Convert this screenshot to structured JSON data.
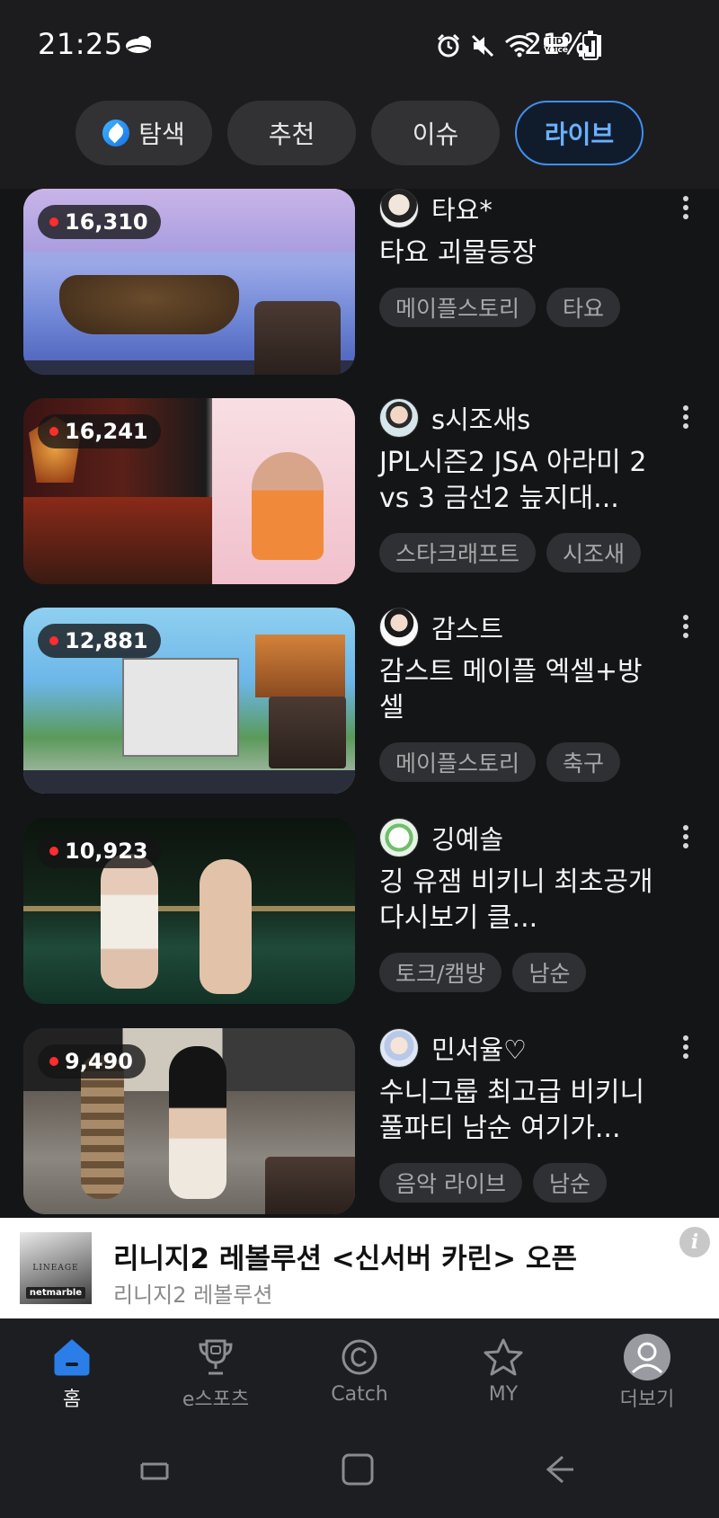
{
  "status_bar": {
    "time": "21:25",
    "battery_text": "21%",
    "hd_voice_top": "HD",
    "hd_voice_bottom": "Voice"
  },
  "tabs": [
    {
      "label": "탐색",
      "icon": "explore-leaf-icon",
      "active": false
    },
    {
      "label": "추천",
      "active": false
    },
    {
      "label": "이슈",
      "active": false
    },
    {
      "label": "라이브",
      "active": true
    }
  ],
  "streams": [
    {
      "viewers": "16,310",
      "channel": "타요*",
      "title": "타요 괴물등장",
      "tags": [
        "메이플스토리",
        "타요"
      ]
    },
    {
      "viewers": "16,241",
      "channel": "s시조새s",
      "title": "JPL시즌2 JSA 아라미 2 vs 3 금선2 늪지대...",
      "tags": [
        "스타크래프트",
        "시조새"
      ]
    },
    {
      "viewers": "12,881",
      "channel": "감스트",
      "title": "감스트 메이플 엑셀+방셀",
      "tags": [
        "메이플스토리",
        "축구"
      ]
    },
    {
      "viewers": "10,923",
      "channel": "깅예솔",
      "title": "깅 유잼 비키니 최초공개 다시보기 클...",
      "tags": [
        "토크/캠방",
        "남순"
      ]
    },
    {
      "viewers": "9,490",
      "channel": "민서율♡",
      "title": "수니그룹 최고급 비키니 풀파티 남순 여기가...",
      "tags": [
        "음악 라이브",
        "남순"
      ]
    }
  ],
  "ad": {
    "title": "리니지2 레볼루션 <신서버 카린> 오픈",
    "subtitle": "리니지2 레볼루션",
    "logo_word": "LINEAGE",
    "logo_brand": "netmarble",
    "info_icon": "info-icon"
  },
  "bottom_nav": [
    {
      "label": "홈",
      "icon": "home-icon",
      "active": true
    },
    {
      "label": "e스포츠",
      "icon": "trophy-icon",
      "active": false
    },
    {
      "label": "Catch",
      "icon": "catch-icon",
      "active": false
    },
    {
      "label": "MY",
      "icon": "star-icon",
      "active": false
    },
    {
      "label": "더보기",
      "icon": "profile-icon",
      "active": false
    }
  ],
  "colors": {
    "accent": "#3f8ff0",
    "live_dot": "#ff2d2d",
    "background": "#141517"
  }
}
